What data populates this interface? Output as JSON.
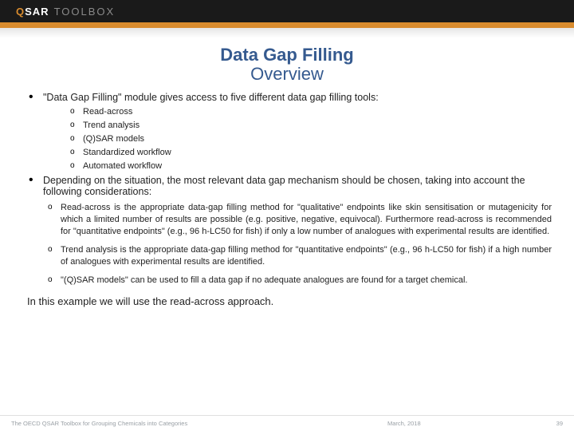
{
  "header": {
    "logo_q": "Q",
    "logo_sar": "SAR",
    "logo_toolbox": "TOOLBOX"
  },
  "title": {
    "main": "Data Gap Filling",
    "sub": "Overview"
  },
  "bullet1": "\"Data Gap Filling\" module gives access to five different data gap filling tools:",
  "tools": {
    "0": "Read-across",
    "1": "Trend analysis",
    "2": "(Q)SAR models",
    "3": "Standardized workflow",
    "4": "Automated workflow"
  },
  "bullet2": "Depending on the situation, the most relevant data gap mechanism should be chosen, taking into account the following considerations:",
  "considerations": {
    "0": "Read-across is the appropriate data-gap filling method for \"qualitative\" endpoints like skin sensitisation or mutagenicity for which a limited number of results are possible (e.g. positive, negative, equivocal). Furthermore read-across is recommended for \"quantitative endpoints\" (e.g., 96 h-LC50 for fish) if only a low number of analogues with experimental results are identified.",
    "1": "Trend analysis is the appropriate data-gap filling method for \"quantitative endpoints\" (e.g., 96 h-LC50 for fish) if a high number of analogues with experimental results are identified.",
    "2": "\"(Q)SAR models\" can be used to fill a data gap if no adequate analogues are found for a target chemical."
  },
  "closing": "In this example we will use the read-across approach.",
  "footer": {
    "left": "The OECD QSAR Toolbox for Grouping Chemicals into Categories",
    "mid": "March, 2018",
    "page": "39"
  }
}
